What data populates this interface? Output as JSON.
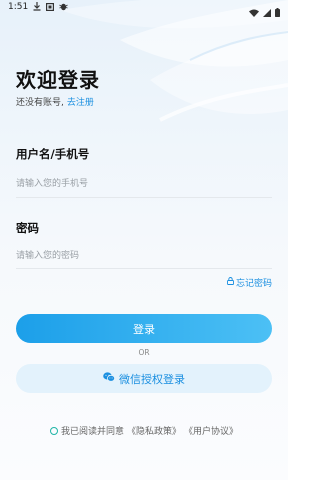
{
  "status_bar": {
    "time": "1:51",
    "icons": [
      "download-icon",
      "square-icon",
      "bug-icon"
    ],
    "right_icons": [
      "wifi-icon",
      "signal-icon",
      "battery-icon"
    ]
  },
  "header": {
    "title": "欢迎登录",
    "no_account_text": "还没有账号,",
    "register_link": "去注册"
  },
  "form": {
    "username_label": "用户名/手机号",
    "username_placeholder": "请输入您的手机号",
    "password_label": "密码",
    "password_placeholder": "请输入您的密码",
    "forgot_password": "忘记密码"
  },
  "actions": {
    "login_button": "登录",
    "or_text": "OR",
    "wechat_button": "微信授权登录"
  },
  "agreement": {
    "prefix": "我已阅读并同意",
    "privacy": "《隐私政策》",
    "user_agreement": "《用户协议》"
  },
  "colors": {
    "accent": "#1a8fe0",
    "button_gradient_start": "#1c9fe9",
    "button_gradient_end": "#4cc0f5",
    "wechat_bg": "#e3f2fc"
  }
}
